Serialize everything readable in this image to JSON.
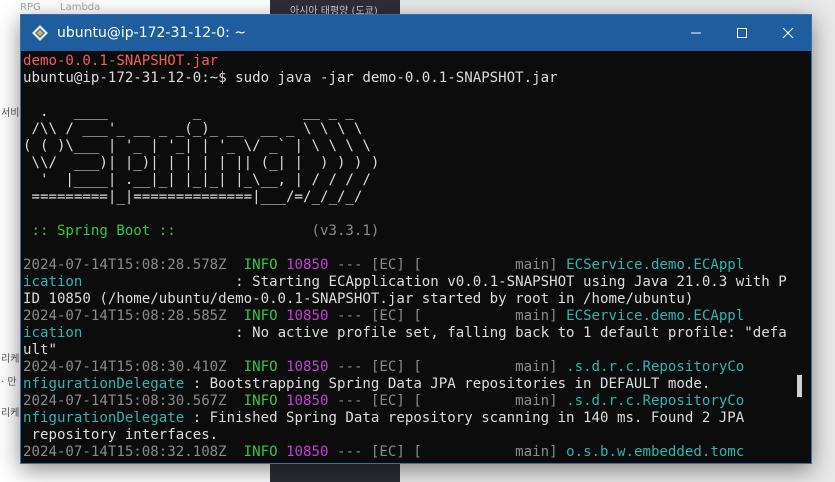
{
  "background": {
    "fragments": [
      "RPG",
      "Lambda",
      "아시아 태평양 (도쿄)",
      "서비",
      "리케",
      "· 만",
      "리케"
    ]
  },
  "window": {
    "title": "ubuntu@ip-172-31-12-0: ~",
    "icon": "ubuntu-tux-icon"
  },
  "terminal": {
    "lines": [
      [
        {
          "t": "demo-0.0.1-SNAPSHOT.jar",
          "c": "red"
        }
      ],
      [
        {
          "t": "ubuntu@ip-172-31-12-0:~$ sudo java -jar demo-0.0.1-SNAPSHOT.jar",
          "c": "white"
        }
      ],
      [
        {
          "t": "",
          "c": "white"
        }
      ],
      [
        {
          "t": "  .   ____          _            __ _ _",
          "c": "white"
        }
      ],
      [
        {
          "t": " /\\\\ / ___'_ __ _ _(_)_ __  __ _ \\ \\ \\ \\",
          "c": "white"
        }
      ],
      [
        {
          "t": "( ( )\\___ | '_ | '_| | '_ \\/ _` | \\ \\ \\ \\",
          "c": "white"
        }
      ],
      [
        {
          "t": " \\\\/  ___)| |_)| | | | | || (_| |  ) ) ) )",
          "c": "white"
        }
      ],
      [
        {
          "t": "  '  |____| .__|_| |_|_| |_\\__, | / / / /",
          "c": "white"
        }
      ],
      [
        {
          "t": " =========|_|==============|___/=/_/_/_/",
          "c": "white"
        }
      ],
      [
        {
          "t": "",
          "c": "white"
        }
      ],
      [
        {
          "t": " :: Spring Boot ::",
          "c": "green"
        },
        {
          "t": "                (v3.3.1)",
          "c": "gray"
        }
      ],
      [
        {
          "t": "",
          "c": "white"
        }
      ],
      [
        {
          "t": "2024-07-14T15:08:28.578Z  ",
          "c": "gray"
        },
        {
          "t": "INFO ",
          "c": "green"
        },
        {
          "t": "10850",
          "c": "magenta"
        },
        {
          "t": " --- [EC] [           main] ",
          "c": "gray"
        },
        {
          "t": "ECService.demo.ECAppl",
          "c": "teal"
        }
      ],
      [
        {
          "t": "ication",
          "c": "teal"
        },
        {
          "t": "                  : Starting ECApplication v0.0.1-SNAPSHOT using Java 21.0.3 with P",
          "c": "white"
        }
      ],
      [
        {
          "t": "ID 10850 (/home/ubuntu/demo-0.0.1-SNAPSHOT.jar started by root in /home/ubuntu)",
          "c": "white"
        }
      ],
      [
        {
          "t": "2024-07-14T15:08:28.585Z  ",
          "c": "gray"
        },
        {
          "t": "INFO ",
          "c": "green"
        },
        {
          "t": "10850",
          "c": "magenta"
        },
        {
          "t": " --- [EC] [           main] ",
          "c": "gray"
        },
        {
          "t": "ECService.demo.ECAppl",
          "c": "teal"
        }
      ],
      [
        {
          "t": "ication",
          "c": "teal"
        },
        {
          "t": "                  : No active profile set, falling back to 1 default profile: \"defa",
          "c": "white"
        }
      ],
      [
        {
          "t": "ult\"",
          "c": "white"
        }
      ],
      [
        {
          "t": "2024-07-14T15:08:30.410Z  ",
          "c": "gray"
        },
        {
          "t": "INFO ",
          "c": "green"
        },
        {
          "t": "10850",
          "c": "magenta"
        },
        {
          "t": " --- [EC] [           main] ",
          "c": "gray"
        },
        {
          "t": ".s.d.r.c.RepositoryCo",
          "c": "teal"
        }
      ],
      [
        {
          "t": "nfigurationDelegate",
          "c": "teal"
        },
        {
          "t": " : Bootstrapping Spring Data JPA repositories in DEFAULT mode.",
          "c": "white"
        }
      ],
      [
        {
          "t": "2024-07-14T15:08:30.567Z  ",
          "c": "gray"
        },
        {
          "t": "INFO ",
          "c": "green"
        },
        {
          "t": "10850",
          "c": "magenta"
        },
        {
          "t": " --- [EC] [           main] ",
          "c": "gray"
        },
        {
          "t": ".s.d.r.c.RepositoryCo",
          "c": "teal"
        }
      ],
      [
        {
          "t": "nfigurationDelegate",
          "c": "teal"
        },
        {
          "t": " : Finished Spring Data repository scanning in 140 ms. Found 2 JPA",
          "c": "white"
        }
      ],
      [
        {
          "t": " repository interfaces.",
          "c": "white"
        }
      ],
      [
        {
          "t": "2024-07-14T15:08:32.108Z  ",
          "c": "gray"
        },
        {
          "t": "INFO ",
          "c": "green"
        },
        {
          "t": "10850",
          "c": "magenta"
        },
        {
          "t": " --- [EC] [           main] ",
          "c": "gray"
        },
        {
          "t": "o.s.b.w.embedded.tomc",
          "c": "teal"
        }
      ]
    ]
  },
  "colors": {
    "titlebar": "#1f5d9e",
    "terminal_bg": "#0c0c0c",
    "error_red": "#f25f5c",
    "info_green": "#33c84a",
    "pid_magenta": "#c73fd6",
    "logger_teal": "#2db5b1"
  }
}
